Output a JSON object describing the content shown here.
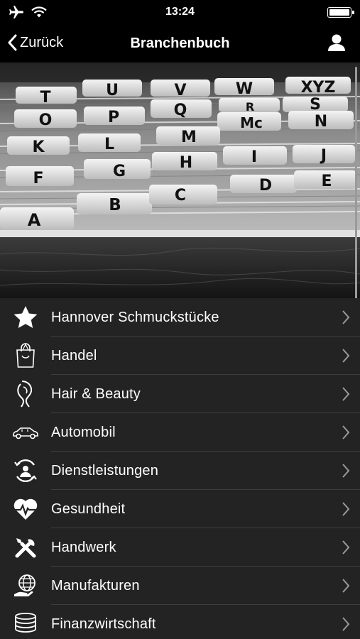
{
  "status_bar": {
    "time": "13:24",
    "icons": [
      "airplane-icon",
      "wifi-icon",
      "battery-icon"
    ]
  },
  "nav": {
    "back_label": "Zurück",
    "title": "Branchenbuch",
    "user_icon": "user-icon"
  },
  "hero": {
    "image": "card-index-drawer-photo",
    "tabs": [
      "T",
      "U",
      "V",
      "W",
      "XYZ",
      "O",
      "P",
      "Q",
      "R",
      "S",
      "Mc",
      "N",
      "K",
      "L",
      "M",
      "H",
      "I",
      "J",
      "F",
      "G",
      "D",
      "E",
      "A",
      "B",
      "C"
    ]
  },
  "categories": [
    {
      "label": "Hannover Schmuckstücke",
      "icon": "star-icon"
    },
    {
      "label": "Handel",
      "icon": "shopping-bag-icon"
    },
    {
      "label": "Hair & Beauty",
      "icon": "hair-icon"
    },
    {
      "label": "Automobil",
      "icon": "car-icon"
    },
    {
      "label": "Dienstleistungen",
      "icon": "service-cycle-icon"
    },
    {
      "label": "Gesundheit",
      "icon": "heart-pulse-icon"
    },
    {
      "label": "Handwerk",
      "icon": "tools-icon"
    },
    {
      "label": "Manufakturen",
      "icon": "globe-hand-icon"
    },
    {
      "label": "Finanzwirtschaft",
      "icon": "coins-icon"
    }
  ]
}
